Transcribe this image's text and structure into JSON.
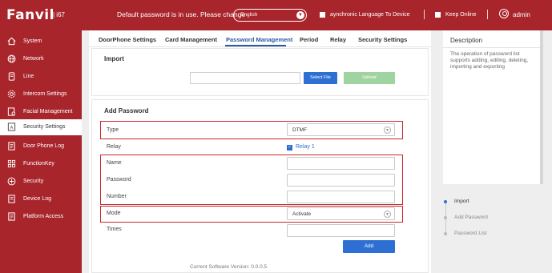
{
  "header": {
    "logo": "Fanvil",
    "model": "| i67",
    "password_warning": "Default password is in use. Please change",
    "language": "English",
    "sync_label": "aynchronic Language To Device",
    "keep_online_label": "Keep Online",
    "user": "admin"
  },
  "sidebar": {
    "items": [
      {
        "label": "System",
        "icon": "home-icon"
      },
      {
        "label": "Network",
        "icon": "globe-icon"
      },
      {
        "label": "Line",
        "icon": "phone-icon"
      },
      {
        "label": "Intercom Settings",
        "icon": "gear-icon"
      },
      {
        "label": "Facial Management",
        "icon": "face-icon"
      },
      {
        "label": "Security Settings",
        "icon": "security-settings-icon",
        "active": true
      },
      {
        "label": "Door Phone Log",
        "icon": "log-icon"
      },
      {
        "label": "FunctionKey",
        "icon": "grid-icon"
      },
      {
        "label": "Security",
        "icon": "shield-icon"
      },
      {
        "label": "Device Log",
        "icon": "device-log-icon"
      },
      {
        "label": "Platform Access",
        "icon": "platform-icon"
      }
    ]
  },
  "tabs": [
    {
      "label": "DoorPhone Settings"
    },
    {
      "label": "Card Management"
    },
    {
      "label": "Password Management",
      "active": true
    },
    {
      "label": "Period"
    },
    {
      "label": "Relay"
    },
    {
      "label": "Security Settings"
    }
  ],
  "import": {
    "title": "Import",
    "select_file": "Select File",
    "upload": "Upload"
  },
  "add_password": {
    "title": "Add Password",
    "type_label": "Type",
    "type_value": "DTMF",
    "relay_label": "Relay",
    "relay_option": "Relay 1",
    "name_label": "Name",
    "password_label": "Password",
    "number_label": "Number",
    "mode_label": "Mode",
    "mode_value": "Activate",
    "times_label": "Times",
    "add_button": "Add"
  },
  "footer": {
    "version": "Current Software Version: 0.0.0.5"
  },
  "description": {
    "title": "Description",
    "text": "The operation of password list supports adding, editing, deleting, importing and exporting"
  },
  "anchors": [
    {
      "label": "Import",
      "active": true
    },
    {
      "label": "Add Password"
    },
    {
      "label": "Password List"
    }
  ],
  "colors": {
    "brand": "#a8252b",
    "accent": "#2b5aa3",
    "highlight": "#c8282e"
  }
}
